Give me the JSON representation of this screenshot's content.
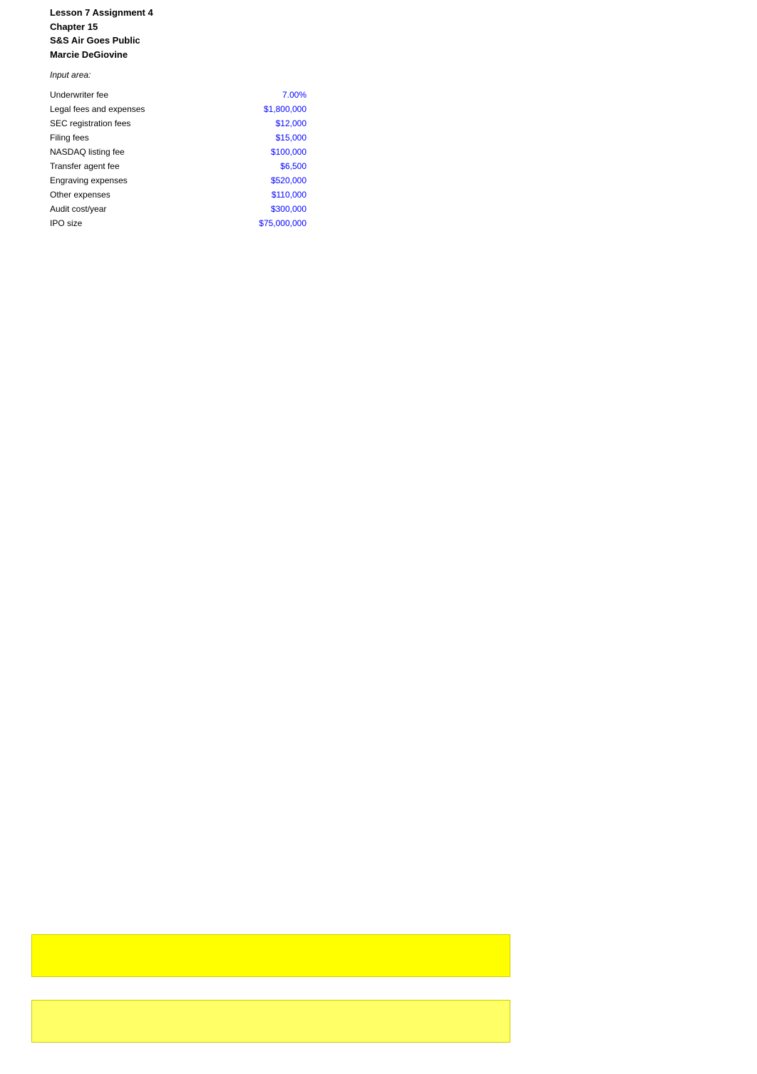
{
  "header": {
    "line1": "Lesson 7  Assignment 4",
    "line2": "Chapter 15",
    "line3": "S&S Air Goes Public",
    "line4": "     Marcie DeGiovine"
  },
  "input_area_label": "Input area:",
  "rows": [
    {
      "label": "Underwriter fee",
      "value": "7.00%"
    },
    {
      "label": "Legal fees and expenses",
      "value": "$1,800,000"
    },
    {
      "label": "SEC registration fees",
      "value": "$12,000"
    },
    {
      "label": "Filing fees",
      "value": "$15,000"
    },
    {
      "label": "NASDAQ listing fee",
      "value": "$100,000"
    },
    {
      "label": "Transfer agent fee",
      "value": "$6,500"
    },
    {
      "label": "Engraving expenses",
      "value": "$520,000"
    },
    {
      "label": "Other expenses",
      "value": "$110,000"
    },
    {
      "label": "Audit cost/year",
      "value": "$300,000"
    },
    {
      "label": "IPO size",
      "value": "$75,000,000"
    }
  ]
}
